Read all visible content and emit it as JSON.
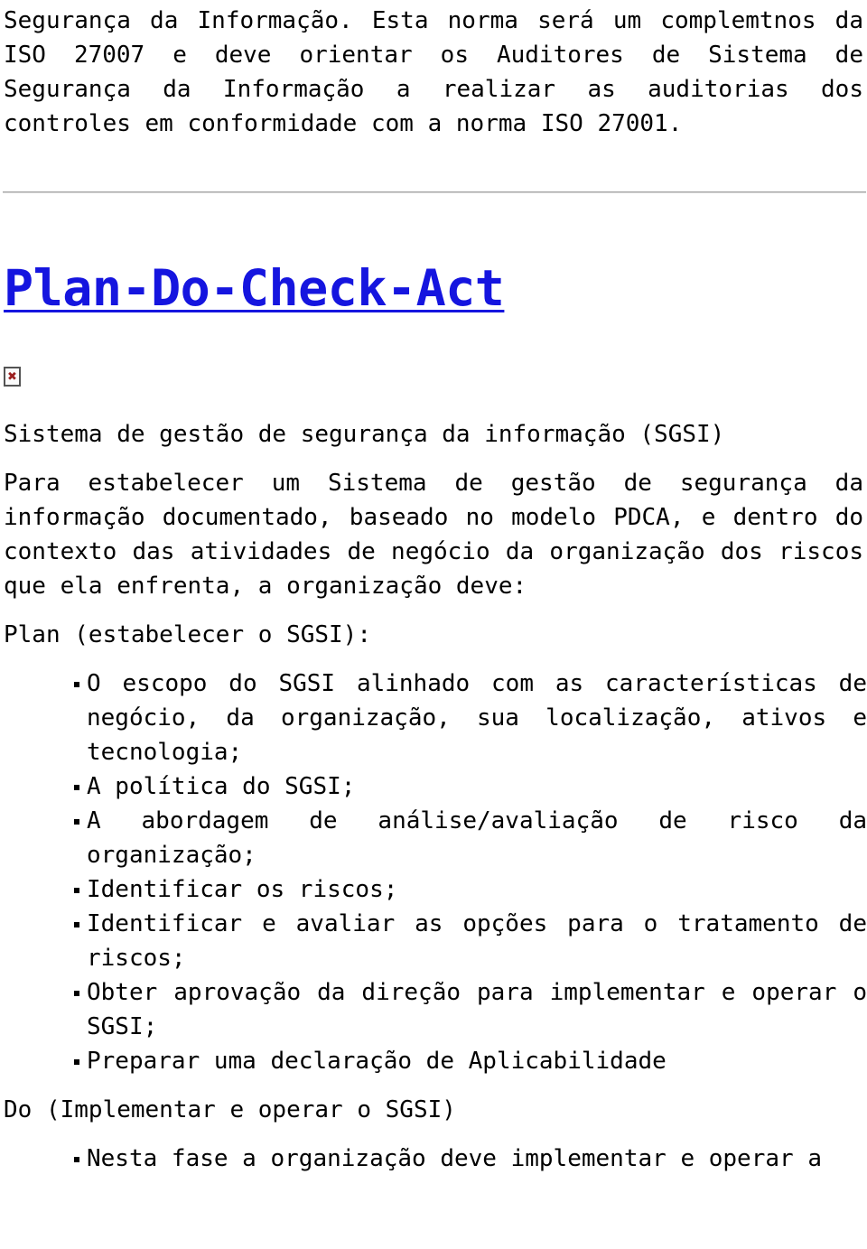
{
  "document": {
    "intro_paragraph": "Segurança da Informação. Esta norma será um complemtnos da ISO 27007 e deve orientar os Auditores de Sistema de Segurança da Informação a realizar as auditorias dos controles em conformidade com a norma ISO 27001.",
    "divider": "horizontal-rule",
    "heading_link": {
      "label": "Plan-Do-Check-Act",
      "color": "#1515df",
      "underlined": true
    },
    "broken_image": {
      "glyph": "✖",
      "alt": "broken-image-placeholder"
    },
    "section_title": "Sistema de gestão de segurança da informação (SGSI)",
    "lead_paragraph": "Para estabelecer um Sistema de gestão de segurança da informação documentado, baseado no modelo PDCA, e dentro do contexto das atividades de negócio da organização dos riscos que ela enfrenta, a organização deve:",
    "plan": {
      "label": "Plan (estabelecer o SGSI):",
      "items": [
        "O escopo do SGSI alinhado com as características de negócio, da organização, sua localização, ativos e tecnologia;",
        "A política do SGSI;",
        "A abordagem de análise/avaliação de risco da organização;",
        "Identificar os riscos;",
        "Identificar e avaliar as opções para o tratamento de riscos;",
        "Obter aprovação da direção para implementar e operar o SGSI;",
        "Preparar uma declaração de Aplicabilidade"
      ]
    },
    "do": {
      "label": "Do (Implementar e operar o SGSI)",
      "items": [
        "Nesta fase a organização deve implementar e operar a"
      ]
    }
  }
}
